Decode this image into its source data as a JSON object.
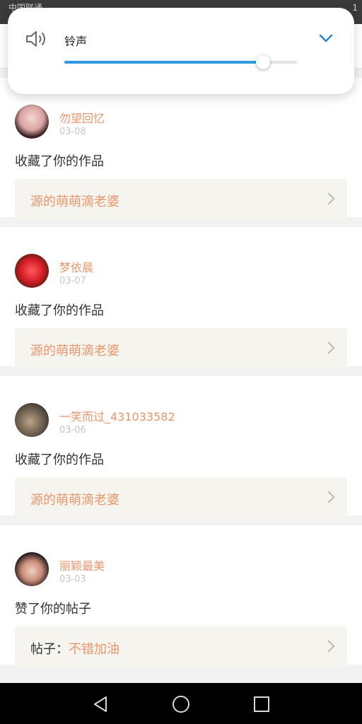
{
  "status_bar": {
    "carrier": "中国联通",
    "right_text": "1"
  },
  "volume": {
    "label": "铃声",
    "level": 0.85
  },
  "feed": [
    {
      "user": "勿望回忆",
      "date": "03-08",
      "action": "收藏了你的作品",
      "link_prefix": "",
      "link_text": "源的萌萌滴老婆"
    },
    {
      "user": "梦依晨",
      "date": "03-07",
      "action": "收藏了你的作品",
      "link_prefix": "",
      "link_text": "源的萌萌滴老婆"
    },
    {
      "user": "一笑而过_431033582",
      "date": "03-06",
      "action": "收藏了你的作品",
      "link_prefix": "",
      "link_text": "源的萌萌滴老婆"
    },
    {
      "user": "丽颖最美",
      "date": "03-03",
      "action": "赞了你的帖子",
      "link_prefix": "帖子：",
      "link_text": "不错加油"
    }
  ],
  "colors": {
    "accent": "#e9966a",
    "slider": "#2f9ae0"
  }
}
